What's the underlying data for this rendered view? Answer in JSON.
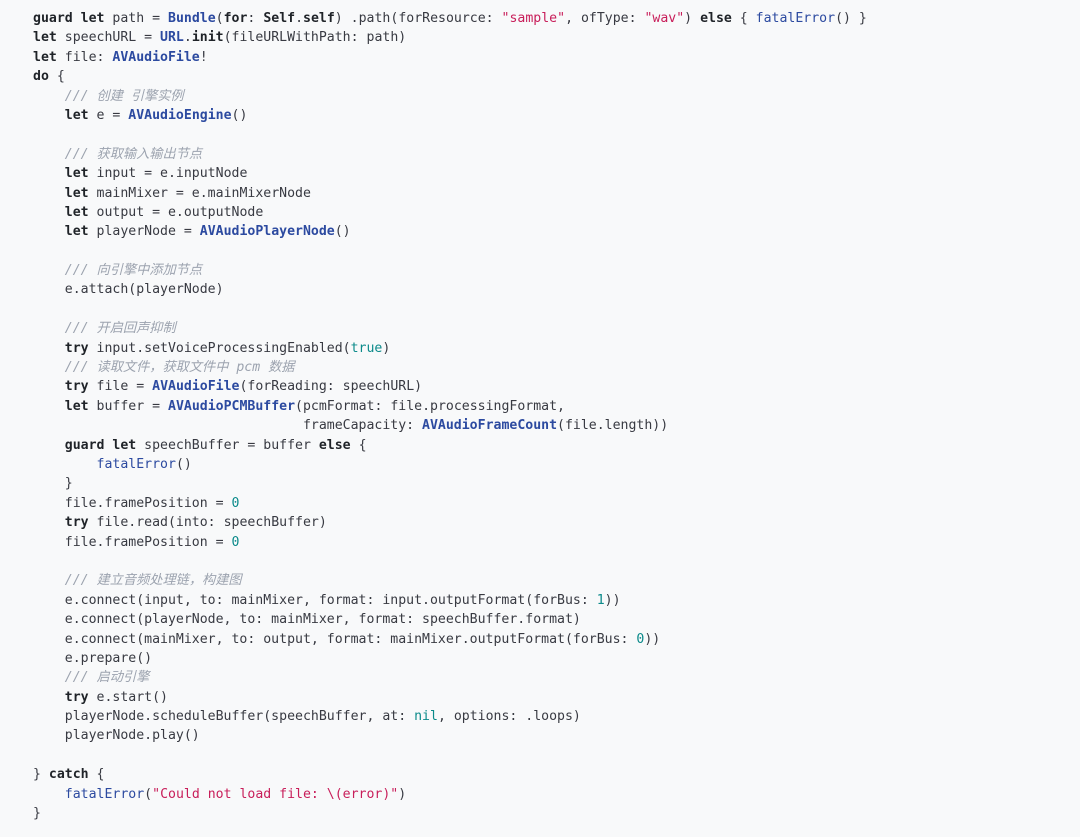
{
  "code_view": {
    "language": "swift",
    "lines": [
      [
        [
          "kw",
          "guard let"
        ],
        [
          "pl",
          " path = "
        ],
        [
          "ty",
          "Bundle"
        ],
        [
          "pl",
          "("
        ],
        [
          "kw",
          "for"
        ],
        [
          "pl",
          ": "
        ],
        [
          "kw",
          "Self"
        ],
        [
          "pl",
          "."
        ],
        [
          "kw",
          "self"
        ],
        [
          "pl",
          ") .path(forResource: "
        ],
        [
          "str",
          "\"sample\""
        ],
        [
          "pl",
          ", ofType: "
        ],
        [
          "str",
          "\"wav\""
        ],
        [
          "pl",
          ") "
        ],
        [
          "kw",
          "else"
        ],
        [
          "pl",
          " { "
        ],
        [
          "fn",
          "fatalError"
        ],
        [
          "pl",
          "() }"
        ]
      ],
      [
        [
          "kw",
          "let"
        ],
        [
          "pl",
          " speechURL = "
        ],
        [
          "ty",
          "URL"
        ],
        [
          "pl",
          "."
        ],
        [
          "kw",
          "init"
        ],
        [
          "pl",
          "(fileURLWithPath: path)"
        ]
      ],
      [
        [
          "kw",
          "let"
        ],
        [
          "pl",
          " file: "
        ],
        [
          "ty",
          "AVAudioFile"
        ],
        [
          "pl",
          "!"
        ]
      ],
      [
        [
          "kw",
          "do"
        ],
        [
          "pl",
          " {"
        ]
      ],
      [
        [
          "pl",
          "    "
        ],
        [
          "cmt",
          "/// 创建 引擎实例"
        ]
      ],
      [
        [
          "pl",
          "    "
        ],
        [
          "kw",
          "let"
        ],
        [
          "pl",
          " e = "
        ],
        [
          "ty",
          "AVAudioEngine"
        ],
        [
          "pl",
          "()"
        ]
      ],
      [],
      [
        [
          "pl",
          "    "
        ],
        [
          "cmt",
          "/// 获取输入输出节点"
        ]
      ],
      [
        [
          "pl",
          "    "
        ],
        [
          "kw",
          "let"
        ],
        [
          "pl",
          " input = e.inputNode"
        ]
      ],
      [
        [
          "pl",
          "    "
        ],
        [
          "kw",
          "let"
        ],
        [
          "pl",
          " mainMixer = e.mainMixerNode"
        ]
      ],
      [
        [
          "pl",
          "    "
        ],
        [
          "kw",
          "let"
        ],
        [
          "pl",
          " output = e.outputNode"
        ]
      ],
      [
        [
          "pl",
          "    "
        ],
        [
          "kw",
          "let"
        ],
        [
          "pl",
          " playerNode = "
        ],
        [
          "ty",
          "AVAudioPlayerNode"
        ],
        [
          "pl",
          "()"
        ]
      ],
      [],
      [
        [
          "pl",
          "    "
        ],
        [
          "cmt",
          "/// 向引擎中添加节点"
        ]
      ],
      [
        [
          "pl",
          "    e.attach(playerNode)"
        ]
      ],
      [],
      [
        [
          "pl",
          "    "
        ],
        [
          "cmt",
          "/// 开启回声抑制"
        ]
      ],
      [
        [
          "pl",
          "    "
        ],
        [
          "kw",
          "try"
        ],
        [
          "pl",
          " input.setVoiceProcessingEnabled("
        ],
        [
          "lit",
          "true"
        ],
        [
          "pl",
          ")"
        ]
      ],
      [
        [
          "pl",
          "    "
        ],
        [
          "cmt",
          "/// 读取文件，获取文件中 pcm 数据"
        ]
      ],
      [
        [
          "pl",
          "    "
        ],
        [
          "kw",
          "try"
        ],
        [
          "pl",
          " file = "
        ],
        [
          "ty",
          "AVAudioFile"
        ],
        [
          "pl",
          "(forReading: speechURL)"
        ]
      ],
      [
        [
          "pl",
          "    "
        ],
        [
          "kw",
          "let"
        ],
        [
          "pl",
          " buffer = "
        ],
        [
          "ty",
          "AVAudioPCMBuffer"
        ],
        [
          "pl",
          "(pcmFormat: file.processingFormat,"
        ]
      ],
      [
        [
          "pl",
          "                                  frameCapacity: "
        ],
        [
          "ty",
          "AVAudioFrameCount"
        ],
        [
          "pl",
          "(file.length))"
        ]
      ],
      [
        [
          "pl",
          "    "
        ],
        [
          "kw",
          "guard let"
        ],
        [
          "pl",
          " speechBuffer = buffer "
        ],
        [
          "kw",
          "else"
        ],
        [
          "pl",
          " {"
        ]
      ],
      [
        [
          "pl",
          "        "
        ],
        [
          "fn",
          "fatalError"
        ],
        [
          "pl",
          "()"
        ]
      ],
      [
        [
          "pl",
          "    }"
        ]
      ],
      [
        [
          "pl",
          "    file.framePosition = "
        ],
        [
          "lit",
          "0"
        ]
      ],
      [
        [
          "pl",
          "    "
        ],
        [
          "kw",
          "try"
        ],
        [
          "pl",
          " file.read(into: speechBuffer)"
        ]
      ],
      [
        [
          "pl",
          "    file.framePosition = "
        ],
        [
          "lit",
          "0"
        ]
      ],
      [],
      [
        [
          "pl",
          "    "
        ],
        [
          "cmt",
          "/// 建立音频处理链，构建图"
        ]
      ],
      [
        [
          "pl",
          "    e.connect(input, to: mainMixer, format: input.outputFormat(forBus: "
        ],
        [
          "lit",
          "1"
        ],
        [
          "pl",
          "))"
        ]
      ],
      [
        [
          "pl",
          "    e.connect(playerNode, to: mainMixer, format: speechBuffer.format)"
        ]
      ],
      [
        [
          "pl",
          "    e.connect(mainMixer, to: output, format: mainMixer.outputFormat(forBus: "
        ],
        [
          "lit",
          "0"
        ],
        [
          "pl",
          "))"
        ]
      ],
      [
        [
          "pl",
          "    e.prepare()"
        ]
      ],
      [
        [
          "pl",
          "    "
        ],
        [
          "cmt",
          "/// 启动引擎"
        ]
      ],
      [
        [
          "pl",
          "    "
        ],
        [
          "kw",
          "try"
        ],
        [
          "pl",
          " e.start()"
        ]
      ],
      [
        [
          "pl",
          "    playerNode.scheduleBuffer(speechBuffer, at: "
        ],
        [
          "lit",
          "nil"
        ],
        [
          "pl",
          ", options: .loops)"
        ]
      ],
      [
        [
          "pl",
          "    playerNode.play()"
        ]
      ],
      [],
      [
        [
          "pl",
          "} "
        ],
        [
          "kw",
          "catch"
        ],
        [
          "pl",
          " {"
        ]
      ],
      [
        [
          "pl",
          "    "
        ],
        [
          "fn",
          "fatalError"
        ],
        [
          "pl",
          "("
        ],
        [
          "str",
          "\"Could not load file: \\(error)\""
        ],
        [
          "pl",
          ")"
        ]
      ],
      [
        [
          "pl",
          "}"
        ]
      ]
    ]
  }
}
